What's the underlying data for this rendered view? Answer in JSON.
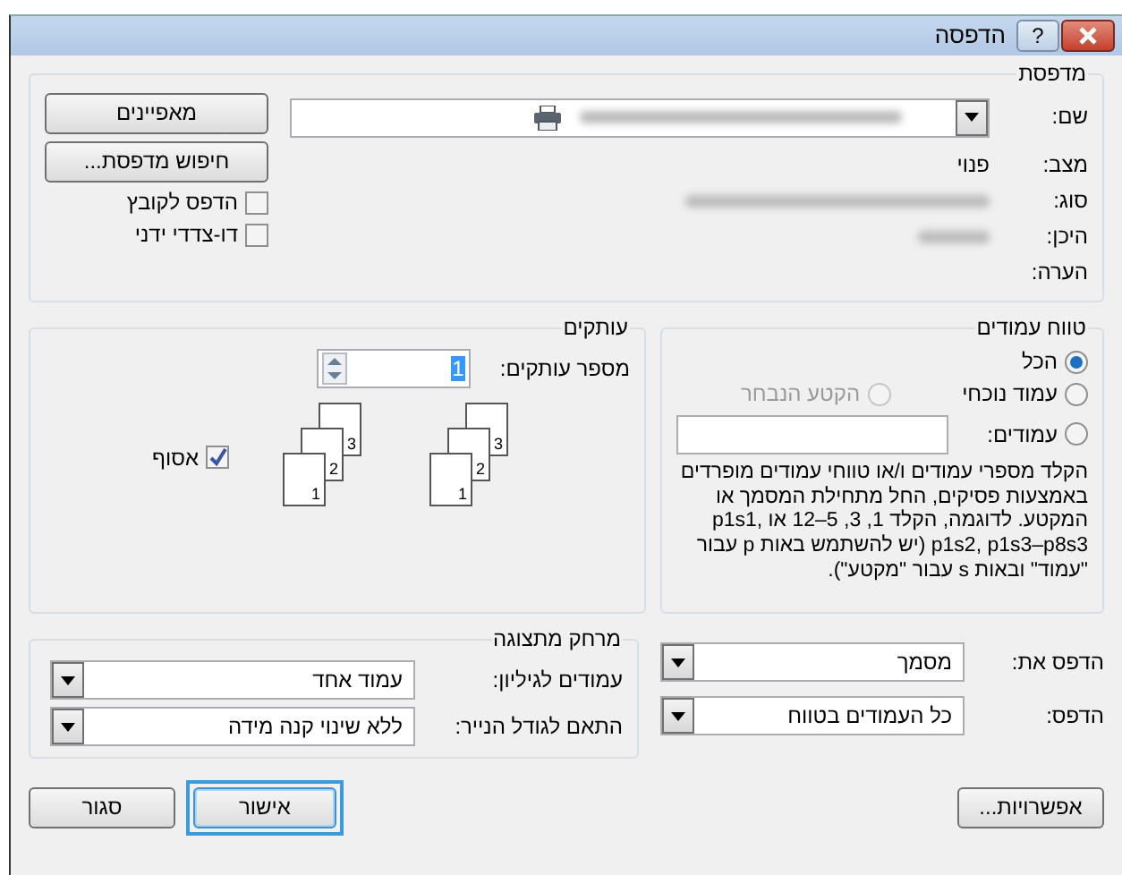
{
  "window": {
    "title": "הדפסה",
    "help_button": "?"
  },
  "printer": {
    "legend": "מדפסת",
    "name_label": "שם:",
    "status_label": "מצב:",
    "status_value": "פנוי",
    "type_label": "סוג:",
    "where_label": "היכן:",
    "comment_label": "הערה:",
    "properties_button": "מאפיינים",
    "find_button": "חיפוש מדפסת...",
    "checkboxes": [
      {
        "label": "הדפס לקובץ",
        "checked": false
      },
      {
        "label": "דו-צדדי ידני",
        "checked": false
      }
    ]
  },
  "page_range": {
    "legend": "טווח עמודים",
    "options": [
      {
        "label": "הכל",
        "selected": true,
        "disabled": false
      },
      {
        "label": "עמוד נוכחי",
        "selected": false,
        "disabled": false
      },
      {
        "label": "הקטע הנבחר",
        "selected": false,
        "disabled": true
      },
      {
        "label": "עמודים:",
        "selected": false,
        "disabled": false
      }
    ],
    "help": "הקלד מספרי עמודים ו/או טווחי עמודים מופרדים באמצעות פסיקים, החל מתחילת המסמך או המקטע. לדוגמה, הקלד 1, 3, 5–12 או p1s1, p1s2, p1s3–p8s3 (יש להשתמש באות p עבור \"עמוד\" ובאות s עבור \"מקטע\")."
  },
  "copies": {
    "legend": "עותקים",
    "label": "מספר עותקים:",
    "value": "1",
    "stacks": [
      [
        "1",
        "2",
        "3"
      ],
      [
        "1",
        "2",
        "3"
      ]
    ],
    "collate": {
      "label": "אסוף",
      "checked": true
    }
  },
  "print_what": {
    "label": "הדפס את:",
    "value": "מסמך"
  },
  "print": {
    "label": "הדפס:",
    "value": "כל העמודים בטווח"
  },
  "zoom": {
    "legend": "מרחק מתצוגה",
    "pages_label": "עמודים לגיליון:",
    "pages_value": "עמוד אחד",
    "scale_label": "התאם לגודל הנייר:",
    "scale_value": "ללא שינוי קנה מידה"
  },
  "buttons": [
    {
      "label": "אפשרויות...",
      "default": false
    },
    {
      "label": "אישור",
      "default": true
    },
    {
      "label": "סגור",
      "default": false
    }
  ]
}
